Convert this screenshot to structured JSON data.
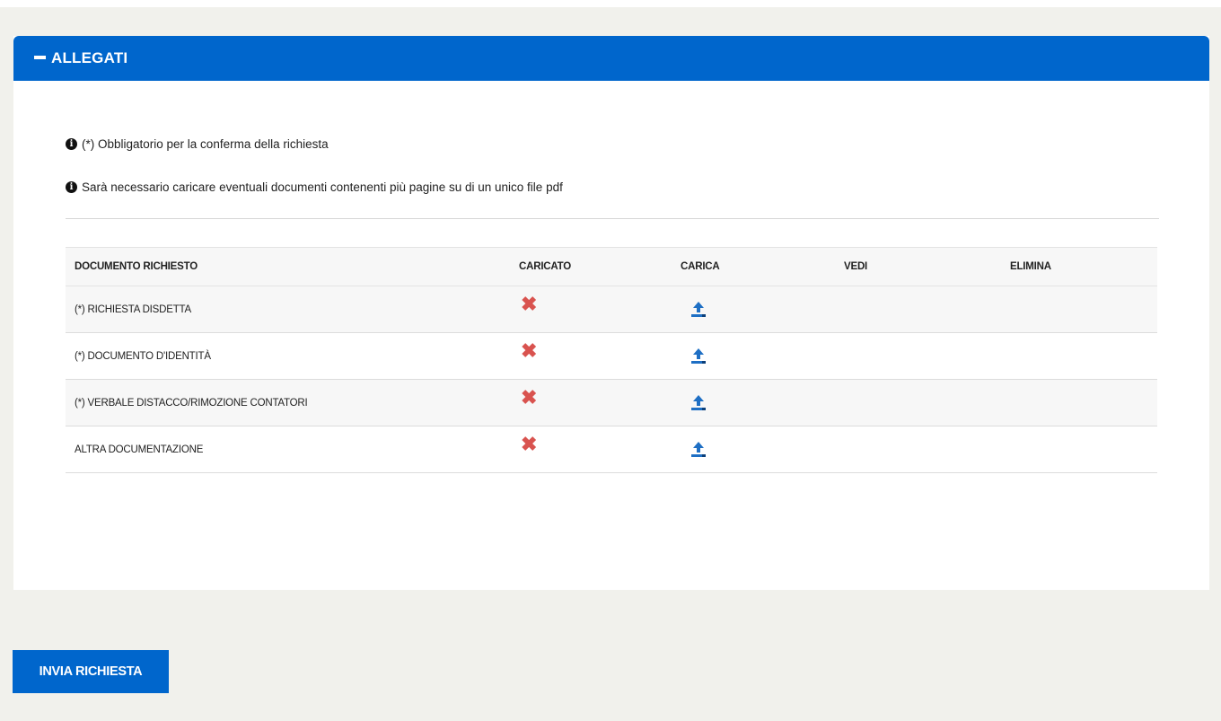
{
  "panel": {
    "title": "ALLEGATI",
    "collapse_icon": "minus-icon"
  },
  "notes": [
    {
      "icon": "info-circle-icon",
      "text": "(*) Obbligatorio per la conferma della richiesta"
    },
    {
      "icon": "info-circle-icon",
      "text": "Sarà necessario caricare eventuali documenti contenenti più pagine su di un unico file pdf"
    }
  ],
  "table": {
    "headers": {
      "document": "DOCUMENTO RICHIESTO",
      "uploaded": "CARICATO",
      "upload": "CARICA",
      "view": "VEDI",
      "delete": "ELIMINA"
    },
    "rows": [
      {
        "document": "(*) RICHIESTA DISDETTA",
        "uploaded_icon": "x-mark-icon",
        "upload_icon": "upload-icon"
      },
      {
        "document": "(*) DOCUMENTO D'IDENTITÀ",
        "uploaded_icon": "x-mark-icon",
        "upload_icon": "upload-icon"
      },
      {
        "document": "(*) VERBALE DISTACCO/RIMOZIONE CONTATORI",
        "uploaded_icon": "x-mark-icon",
        "upload_icon": "upload-icon"
      },
      {
        "document": "ALTRA DOCUMENTAZIONE",
        "uploaded_icon": "x-mark-icon",
        "upload_icon": "upload-icon"
      }
    ]
  },
  "actions": {
    "send_label": "INVIA RICHIESTA"
  },
  "colors": {
    "primary": "#0066cc",
    "danger": "#d9534f",
    "background": "#f1f1ec"
  }
}
